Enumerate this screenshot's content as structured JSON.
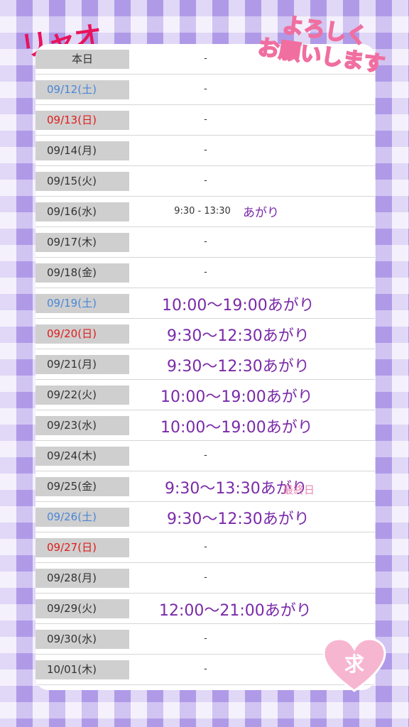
{
  "title": "リャオ",
  "greeting": [
    "よろしく",
    "お願いします"
  ],
  "heart_char": "求",
  "schedule": [
    {
      "date": "本日",
      "type": "today",
      "value": "-"
    },
    {
      "date": "09/12(土)",
      "type": "sat",
      "value": "-"
    },
    {
      "date": "09/13(日)",
      "type": "sun",
      "value": "-"
    },
    {
      "date": "09/14(月)",
      "type": "week",
      "value": "-"
    },
    {
      "date": "09/15(火)",
      "type": "week",
      "value": "-"
    },
    {
      "date": "09/16(水)",
      "type": "week",
      "value": "9:30 - 13:30",
      "note": "あがり"
    },
    {
      "date": "09/17(木)",
      "type": "week",
      "value": "-"
    },
    {
      "date": "09/18(金)",
      "type": "week",
      "value": "-"
    },
    {
      "date": "09/19(土)",
      "type": "sat",
      "value": "",
      "handwritten": "10:00〜19:00あがり"
    },
    {
      "date": "09/20(日)",
      "type": "sun",
      "value": "",
      "handwritten": "9:30〜12:30あがり"
    },
    {
      "date": "09/21(月)",
      "type": "week",
      "value": "",
      "handwritten": "9:30〜12:30あがり"
    },
    {
      "date": "09/22(火)",
      "type": "week",
      "value": "",
      "handwritten": "10:00〜19:00あがり"
    },
    {
      "date": "09/23(水)",
      "type": "week",
      "value": "",
      "handwritten": "10:00〜19:00あがり"
    },
    {
      "date": "09/24(木)",
      "type": "week",
      "value": "-"
    },
    {
      "date": "09/25(金)",
      "type": "week",
      "value": "",
      "handwritten": "9:30〜13:30あがり"
    },
    {
      "date": "09/26(土)",
      "type": "sat",
      "value": "",
      "handwritten": "9:30〜12:30あがり"
    },
    {
      "date": "09/27(日)",
      "type": "sun",
      "value": "-"
    },
    {
      "date": "09/28(月)",
      "type": "week",
      "value": "-"
    },
    {
      "date": "09/29(火)",
      "type": "week",
      "value": "",
      "handwritten": "12:00〜21:00あがり"
    },
    {
      "date": "09/30(水)",
      "type": "week",
      "value": "-"
    },
    {
      "date": "10/01(木)",
      "type": "week",
      "value": "-"
    }
  ],
  "faint_text": "最終日"
}
